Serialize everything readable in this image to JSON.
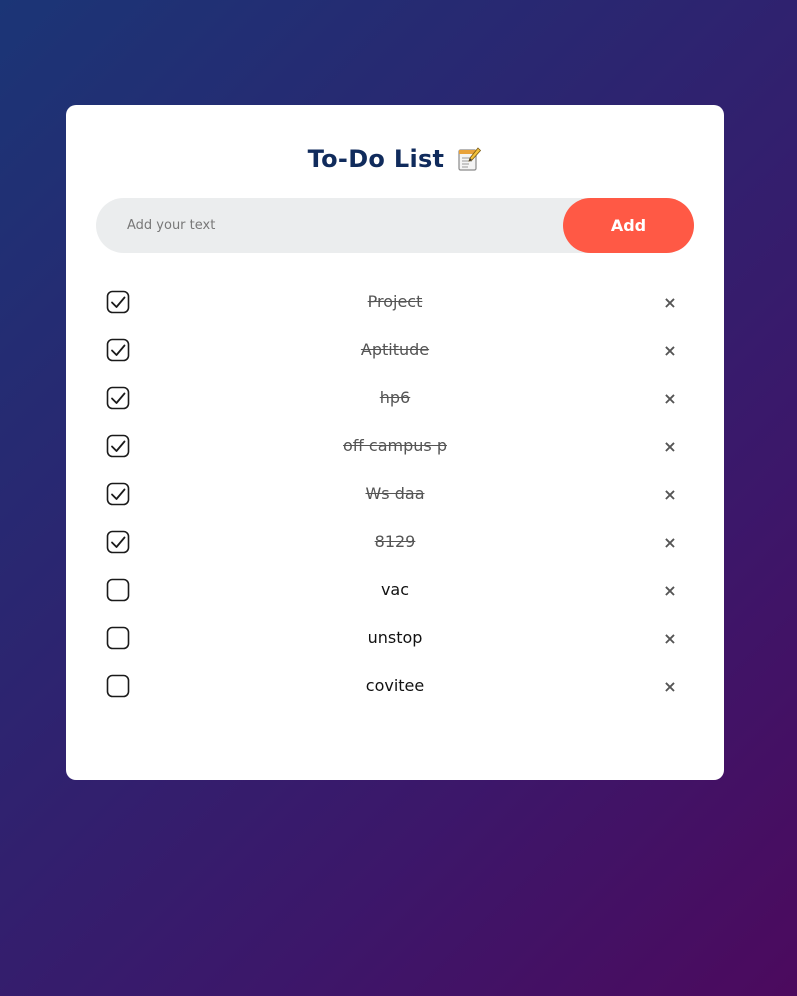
{
  "app": {
    "title": "To-Do List",
    "title_icon": "notepad-icon"
  },
  "input": {
    "placeholder": "Add your text",
    "value": ""
  },
  "add_button": {
    "label": "Add",
    "color": "#ff5945"
  },
  "delete_glyph": "×",
  "colors": {
    "title": "#102b5c",
    "card": "#ffffff",
    "input_bg": "#ebedee",
    "done_text": "#555555"
  },
  "tasks": [
    {
      "text": "Project",
      "done": true
    },
    {
      "text": "Aptitude",
      "done": true
    },
    {
      "text": "hp6",
      "done": true
    },
    {
      "text": "off campus p",
      "done": true
    },
    {
      "text": "Ws daa",
      "done": true
    },
    {
      "text": "8129",
      "done": true
    },
    {
      "text": "vac",
      "done": false
    },
    {
      "text": "unstop",
      "done": false
    },
    {
      "text": "covitee",
      "done": false
    }
  ]
}
